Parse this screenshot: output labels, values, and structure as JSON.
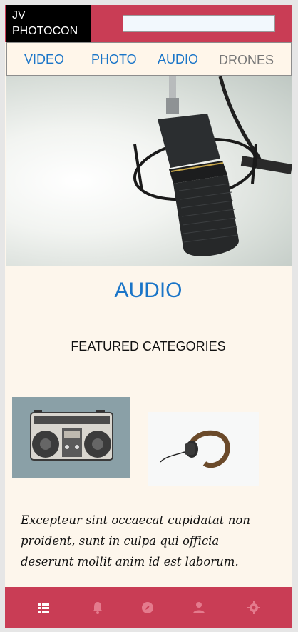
{
  "header": {
    "logo_line1": "JV",
    "logo_line2": "PHOTOCON",
    "search_value": ""
  },
  "nav": {
    "items": [
      {
        "label": "VIDEO"
      },
      {
        "label": "PHOTO"
      },
      {
        "label": "AUDIO"
      },
      {
        "label": "DRONES"
      }
    ]
  },
  "main": {
    "title": "AUDIO",
    "featured_heading": "FEATURED CATEGORIES",
    "description": "Excepteur sint occaecat cupidatat non proident, sunt in culpa qui officia deserunt mollit anim id est laborum."
  },
  "bottom_nav": {
    "icons": [
      "list-icon",
      "bell-icon",
      "compass-icon",
      "user-icon",
      "settings-icon"
    ]
  },
  "colors": {
    "accent": "#c93d55",
    "link": "#1a75c8",
    "background": "#fdf6ec"
  }
}
